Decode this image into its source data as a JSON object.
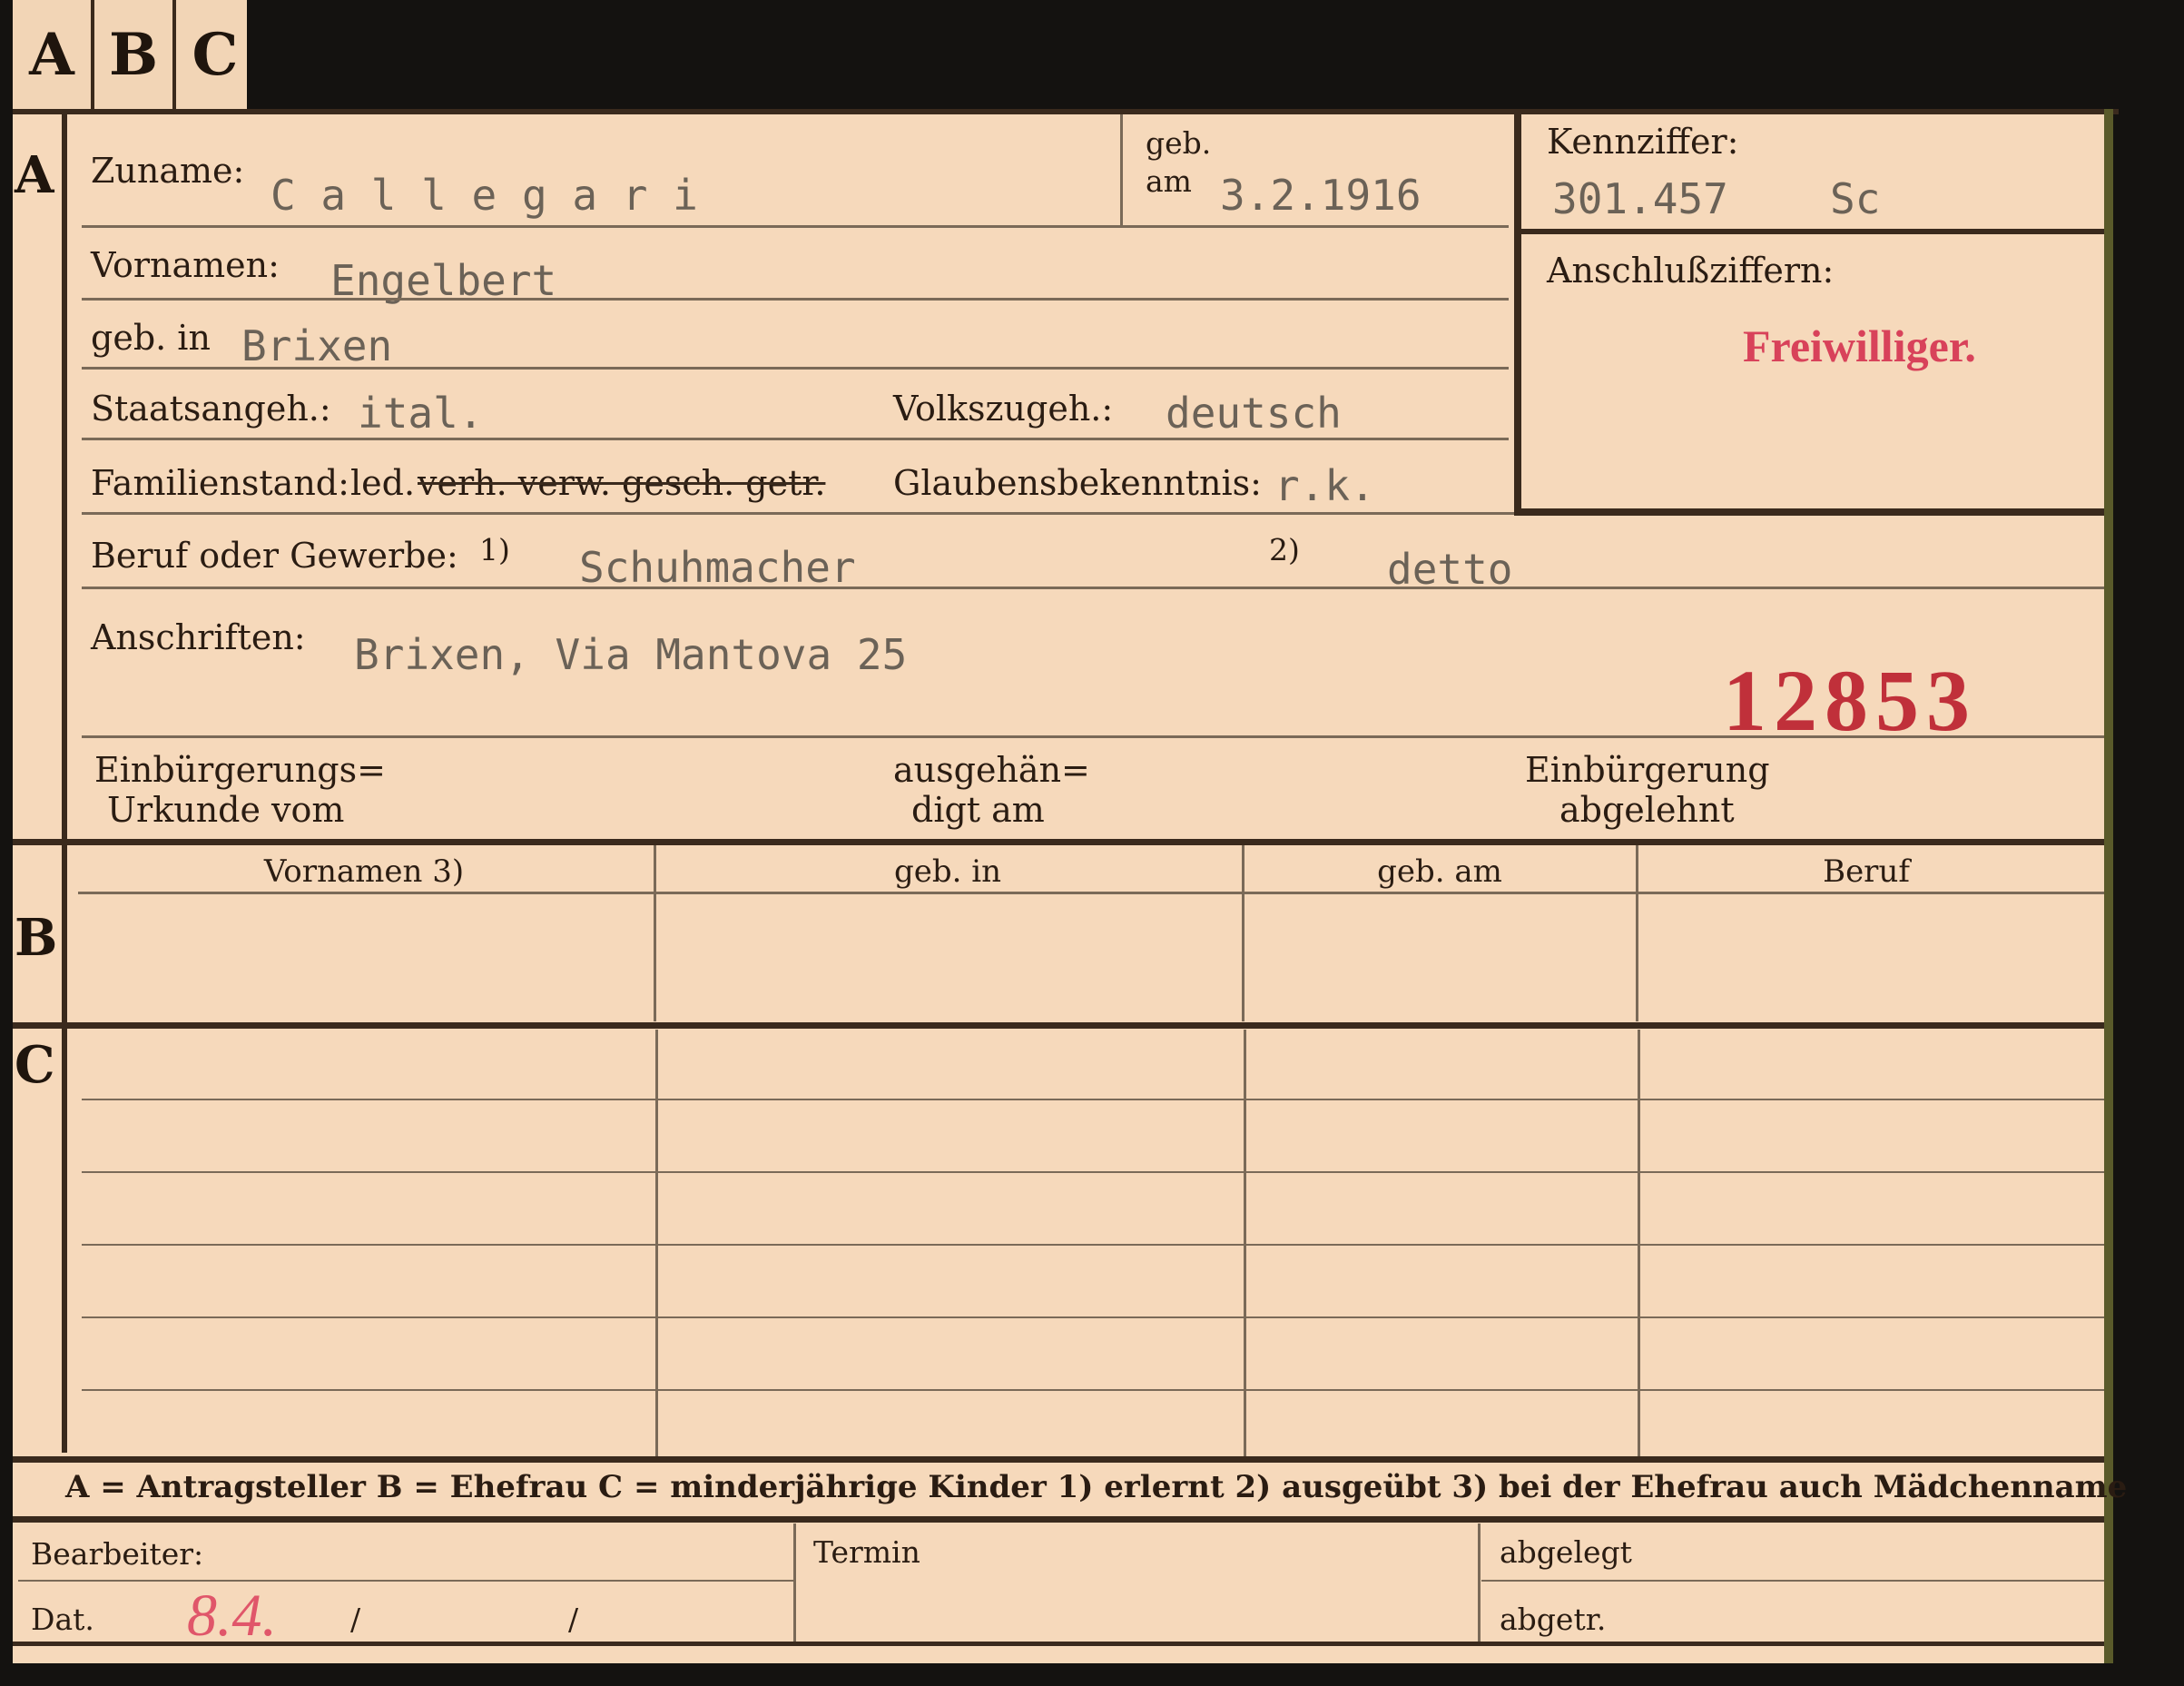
{
  "tabs": [
    "A",
    "B",
    "C"
  ],
  "section_letters": {
    "a": "A",
    "b": "B",
    "c": "C"
  },
  "labels": {
    "zuname": "Zuname:",
    "geb": "geb.",
    "am": "am",
    "kennziffer": "Kennziffer:",
    "vornamen": "Vornamen:",
    "anschluss": "Anschlußziffern:",
    "geb_in": "geb. in",
    "staatsangeh": "Staatsangeh.:",
    "volkszugeh": "Volkszugeh.:",
    "familienstand": "Familienstand:",
    "fam_led": "led.",
    "fam_crossed": "verh. verw. gesch. getr.",
    "glauben": "Glaubensbekenntnis:",
    "beruf": "Beruf oder Gewerbe:",
    "beruf_note1": "1)",
    "beruf_note2": "2)",
    "anschriften": "Anschriften:",
    "einb_urkunde_1": "Einbürgerungs=",
    "einb_urkunde_2": "Urkunde vom",
    "ausgehaend_1": "ausgehän=",
    "ausgehaend_2": "digt am",
    "einb_abgel_1": "Einbürgerung",
    "einb_abgel_2": "abgelehnt"
  },
  "values": {
    "zuname": "C a l l e g a r i",
    "geb_am": "3.2.1916",
    "kennziffer": "301.457",
    "kennziffer_suffix": "Sc",
    "vornamen": "Engelbert",
    "geb_in": "Brixen",
    "staatsangeh": "ital.",
    "volkszugeh": "deutsch",
    "glauben": "r.k.",
    "beruf_erlernt": "Schuhmacher",
    "beruf_ausgeuebt": "detto",
    "anschrift": "Brixen, Via Mantova 25"
  },
  "stamps": {
    "freiwilliger": "Freiwilliger.",
    "number": "12853"
  },
  "columns_b": [
    "Vornamen 3)",
    "geb. in",
    "geb. am",
    "Beruf"
  ],
  "legend": "A = Antragsteller   B = Ehefrau   C = minderjährige Kinder   1) erlernt   2) ausgeübt   3) bei der Ehefrau auch Mädchenname",
  "footer": {
    "bearbeiter": "Bearbeiter:",
    "termin": "Termin",
    "abgelegt": "abgelegt",
    "dat": "Dat.",
    "dat_handwritten": "8.4.",
    "dat_sep1": "/",
    "dat_sep2": "/",
    "abgetr": "abgetr."
  },
  "colors": {
    "card": "#f6d9bb",
    "ink": "#2a1c12",
    "typewriter": "#6b6257",
    "red_stamp": "#d8425a",
    "red_number": "#c0303a"
  }
}
